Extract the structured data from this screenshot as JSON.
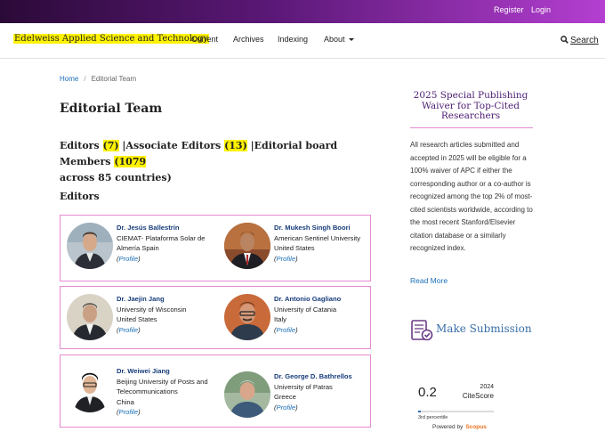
{
  "topbar": {
    "register": "Register",
    "login": "Login"
  },
  "nav": {
    "site_title": "Edelweiss Applied Science and Technology",
    "items": [
      "Current",
      "Archives",
      "Indexing",
      "About"
    ],
    "search": "Search"
  },
  "breadcrumb": {
    "home": "Home",
    "separator": "/",
    "current": "Editorial Team"
  },
  "page_title": "Editorial Team",
  "summary": {
    "editors_label": "Editors ",
    "editors_count": "(7)",
    "associate_label": " |Associate Editors ",
    "associate_count": "(13)",
    "board_label": " |Editorial board Members ",
    "board_count": "(1079 ",
    "tail": "across 85 countries)"
  },
  "section_heading": "Editors",
  "editors": [
    {
      "name": "Dr. Jesús Ballestrín",
      "affiliation": "CIEMAT- Plataforma Solar de Almería Spain",
      "country": "",
      "profile": "Profile"
    },
    {
      "name": "Dr. Mukesh Singh Boori",
      "affiliation": "American Sentinel University",
      "country": "United States",
      "profile": "Profile"
    },
    {
      "name": "Dr. Jaejin Jang",
      "affiliation": "University of Wisconsin",
      "country": "United States",
      "profile": "Profile"
    },
    {
      "name": "Dr. Antonio Gagliano",
      "affiliation": "University of Catania",
      "country": "Italy",
      "profile": "Profile"
    },
    {
      "name": "Dr. Weiwei Jiang",
      "affiliation": "Beijing University of Posts and Telecommunications",
      "country": "China",
      "profile": "Profile"
    },
    {
      "name": "Dr. George D. Bathrellos",
      "affiliation": "University of Patras",
      "country": "Greece",
      "profile": "Profile"
    }
  ],
  "sidebar": {
    "promo_title": "2025 Special Publishing Waiver for Top-Cited Researchers",
    "promo_text": "All research articles submitted and accepted in 2025 will be eligible for a 100% waiver of APC if either the corresponding author or a co-author is recognized among the top 2% of most-cited scientists worldwide, according to the most recent Stanford/Elsevier citation database or a similarly recognized index.",
    "read_more": "Read More",
    "submission": "Make Submission",
    "citescore": {
      "value": "0.2",
      "year": "2024",
      "label": "CiteScore",
      "percentile_text": "3rd percentile",
      "percentile": 0.03,
      "powered_by": "Powered by",
      "brand": "Scopus"
    }
  },
  "colors": {
    "accent": "#b43fd1",
    "highlight": "#fff200",
    "link": "#1a6fb8",
    "box_border": "#e68ad2"
  }
}
